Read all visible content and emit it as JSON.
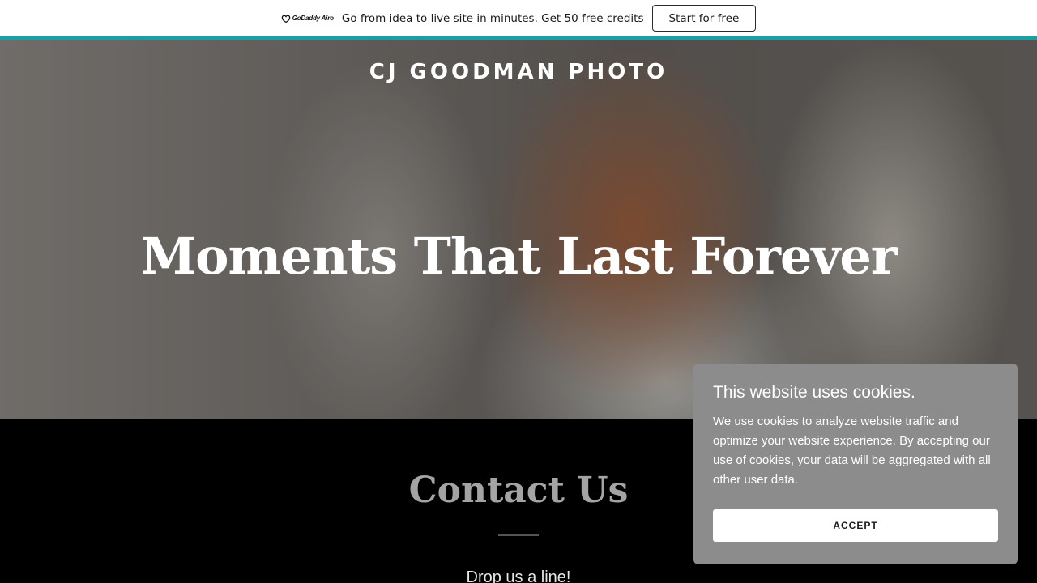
{
  "promo": {
    "logo_text": "GoDaddy Airo",
    "message": "Go from idea to live site in minutes. Get 50 free credits",
    "cta_label": "Start for free",
    "accent_color": "#1e9ea3"
  },
  "hero": {
    "site_title": "CJ GOODMAN PHOTO",
    "heading": "Moments That Last Forever"
  },
  "contact": {
    "heading": "Contact Us",
    "subheading": "Drop us a line!"
  },
  "cookie": {
    "title": "This website uses cookies.",
    "body": "We use cookies to analyze website traffic and optimize your website experience. By accepting our use of cookies, your data will be aggregated with all other user data.",
    "accept_label": "ACCEPT"
  }
}
